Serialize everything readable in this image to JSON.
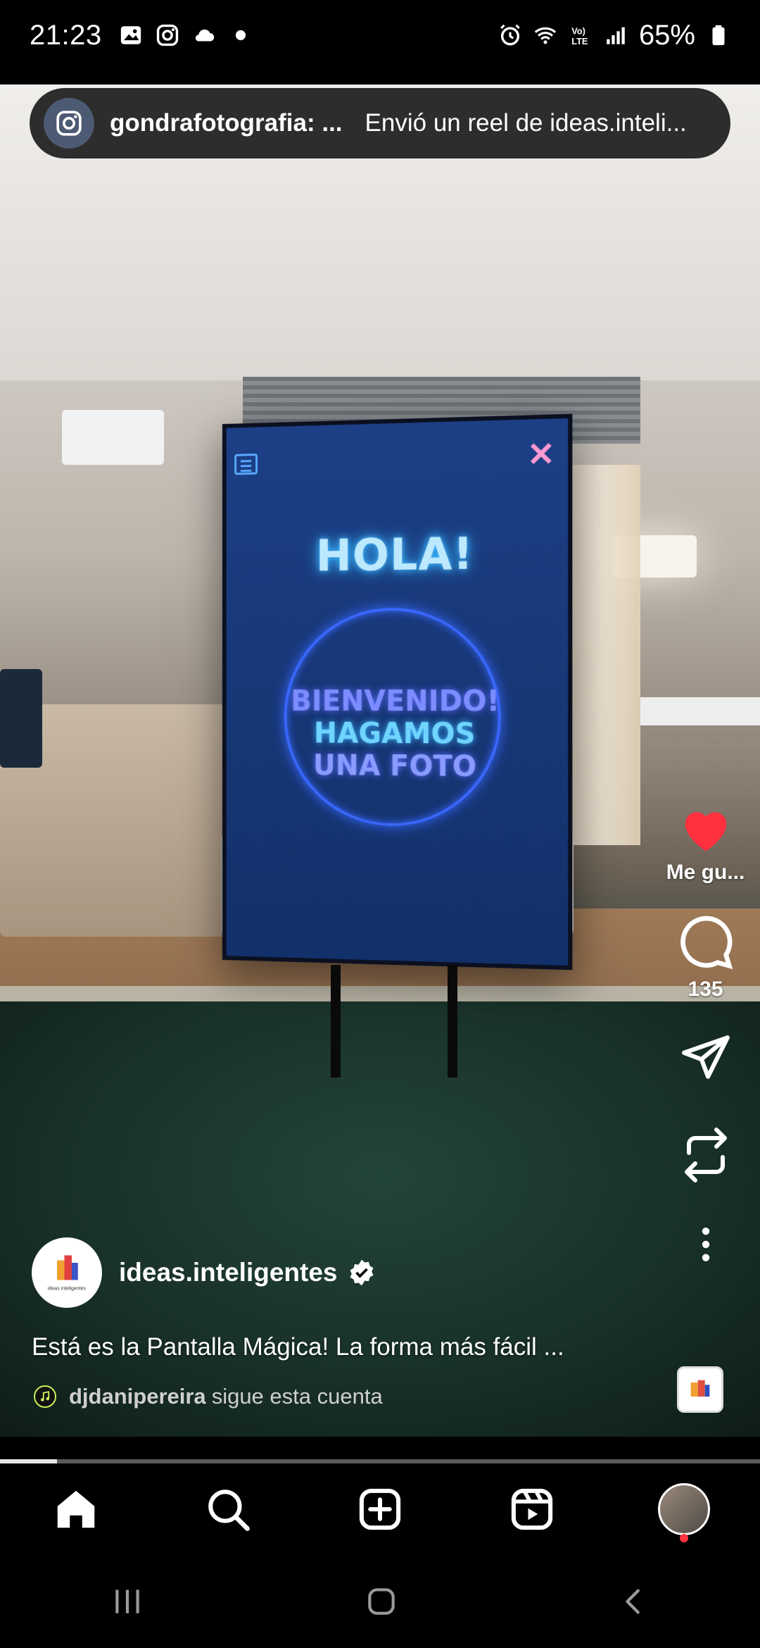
{
  "status_bar": {
    "time": "21:23",
    "battery": "65%",
    "icons": [
      "gallery-icon",
      "instagram-icon",
      "cloud-icon",
      "dot-icon",
      "alarm-icon",
      "wifi-icon",
      "volte-icon",
      "signal-icon",
      "battery-icon"
    ]
  },
  "dm_banner": {
    "sender": "gondrafotografia: ...",
    "message": "Envió un reel de ideas.inteli..."
  },
  "tv_screen": {
    "greeting": "HOLA!",
    "line1": "BIENVENIDO!",
    "line2": "HAGAMOS",
    "line3": "UNA FOTO"
  },
  "actions": {
    "like_label": "Me gu...",
    "comments_count": "135"
  },
  "author": {
    "username": "ideas.inteligentes",
    "avatar_text": "ideas inteligentes"
  },
  "caption": "Está es la Pantalla Mágica! La forma más fácil ...",
  "follow_note": {
    "username": "djdanipereira",
    "text": "sigue esta cuenta"
  },
  "progress": {
    "fraction": 0.075
  },
  "colors": {
    "like": "#ff3040",
    "background": "#000000",
    "banner": "#262626"
  },
  "bottom_nav": [
    "home-icon",
    "search-icon",
    "create-icon",
    "reels-icon",
    "profile-avatar"
  ],
  "system_nav": [
    "recents-icon",
    "home-button-icon",
    "back-icon"
  ]
}
